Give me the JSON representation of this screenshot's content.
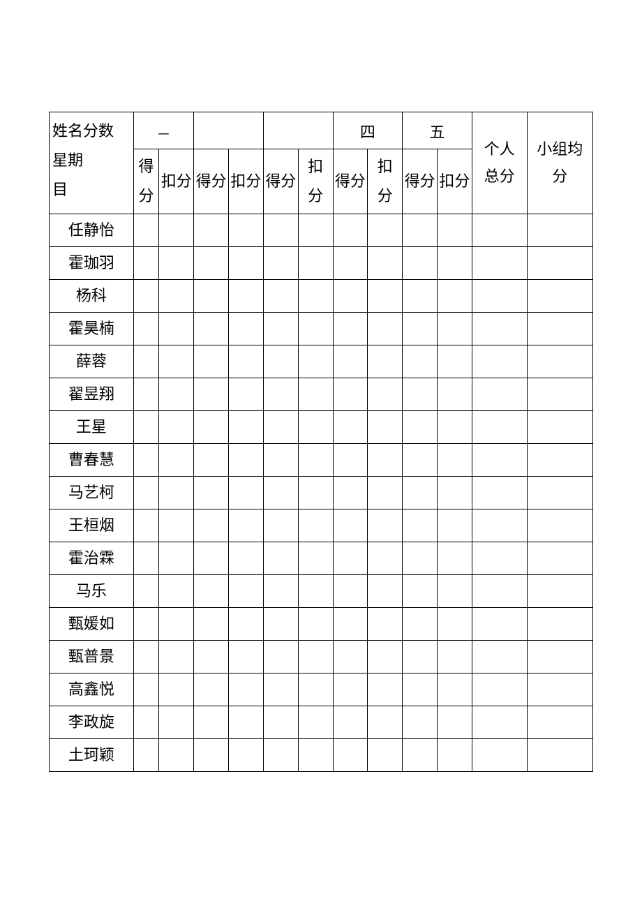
{
  "header": {
    "corner_line1": "姓名分数",
    "corner_line2": "星期",
    "corner_line3": "目",
    "day1_label": "一",
    "day2_label": "",
    "day3_label": "",
    "day4_label": "四",
    "day5_label": "五",
    "personal_total_line1": "个人",
    "personal_total_line2": "总分",
    "group_avg_line1": "小组均",
    "group_avg_line2": "分"
  },
  "subheader": {
    "gain": "得分",
    "gain_stack1": "得",
    "gain_stack2": "分",
    "deduct": "扣分",
    "deduct_stack1": "扣",
    "deduct_stack2": "分"
  },
  "students": [
    "任静怡",
    "霍珈羽",
    "杨科",
    "霍昊楠",
    "薛蓉",
    "翟昱翔",
    "王星",
    "曹春慧",
    "马艺柯",
    "王桓烟",
    "霍治霖",
    "马乐",
    "甄媛如",
    "甄普景",
    "高鑫悦",
    "李政旋",
    "土珂颖"
  ]
}
